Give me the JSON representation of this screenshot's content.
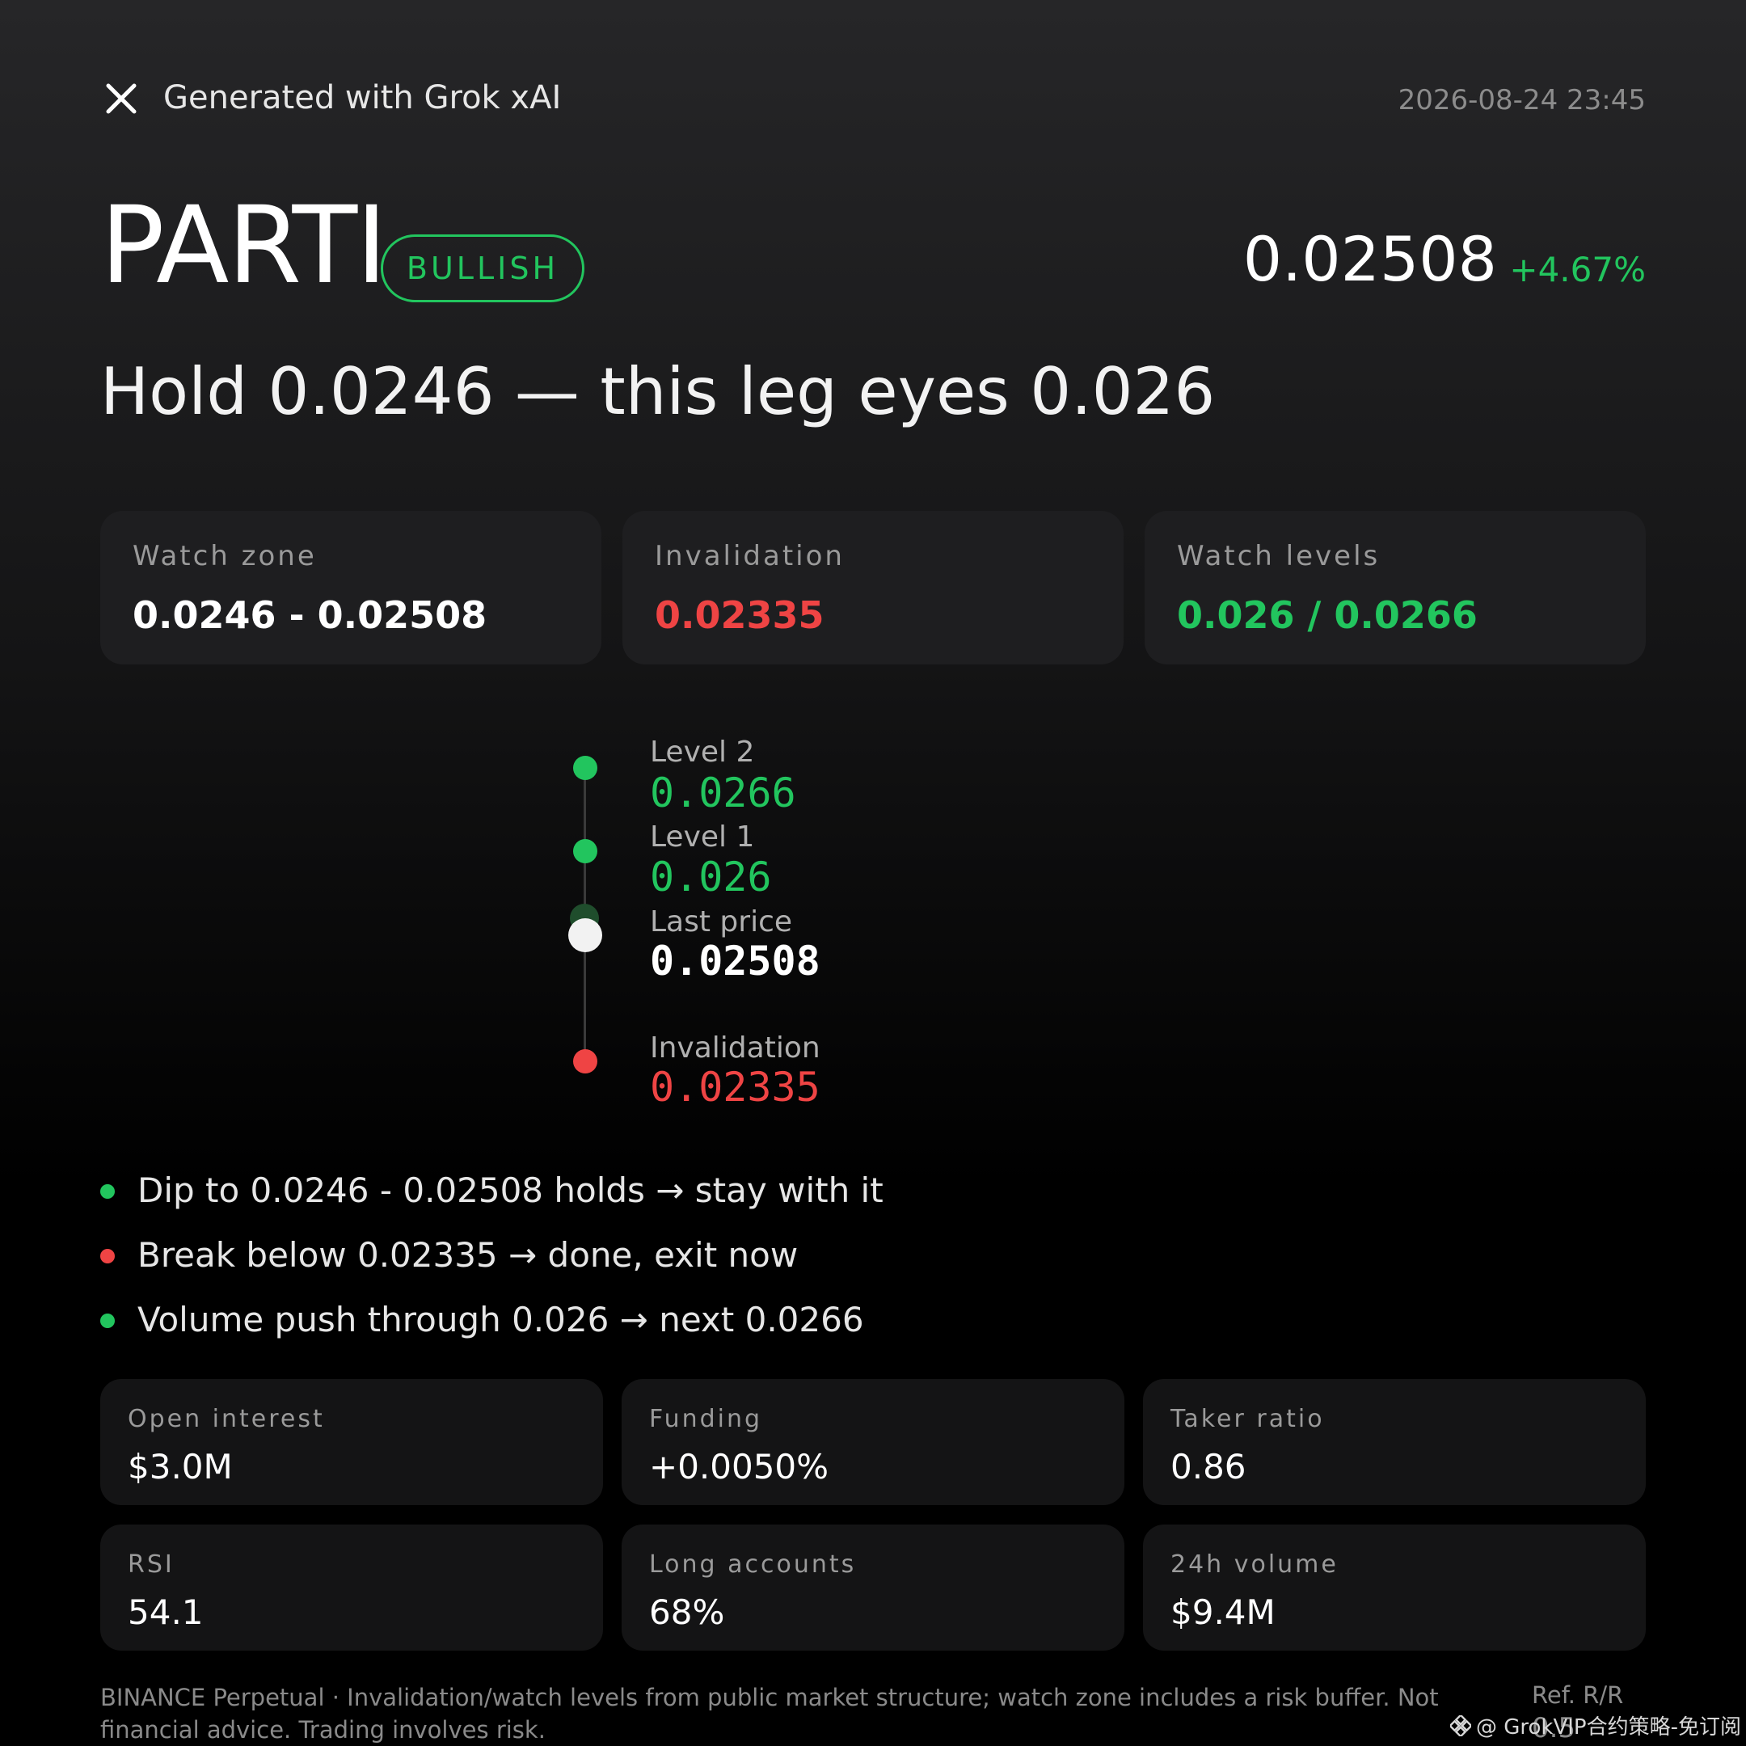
{
  "header": {
    "brand": "Generated with Grok xAI",
    "timestamp": "2026-08-24 23:45"
  },
  "title": {
    "symbol": "PARTI",
    "badge": "BULLISH",
    "price": "0.02508",
    "change": "+4.67%",
    "headline": "Hold 0.0246 — this leg eyes 0.026"
  },
  "level_cards": [
    {
      "label": "Watch zone",
      "value": "0.0246 - 0.02508"
    },
    {
      "label": "Invalidation",
      "value": "0.02335"
    },
    {
      "label": "Watch levels",
      "value": "0.026 / 0.0266"
    }
  ],
  "ladder": [
    {
      "label": "Level 2",
      "value": "0.0266"
    },
    {
      "label": "Level 1",
      "value": "0.026"
    },
    {
      "label": "Last price",
      "value": "0.02508"
    },
    {
      "label": "Invalidation",
      "value": "0.02335"
    }
  ],
  "bullets": [
    {
      "text": "Dip to 0.0246 - 0.02508 holds → stay with it",
      "status": "positive"
    },
    {
      "text": "Break below 0.02335 → done, exit now",
      "status": "negative"
    },
    {
      "text": "Volume push through 0.026 → next 0.0266",
      "status": "positive"
    }
  ],
  "stats": [
    {
      "label": "Open interest",
      "value": "$3.0M"
    },
    {
      "label": "Funding",
      "value": "+0.0050%"
    },
    {
      "label": "Taker ratio",
      "value": "0.86"
    },
    {
      "label": "RSI",
      "value": "54.1"
    },
    {
      "label": "Long accounts",
      "value": "68%"
    },
    {
      "label": "24h volume",
      "value": "$9.4M"
    }
  ],
  "footer": {
    "disclaimer": "BINANCE Perpetual · Invalidation/watch levels from public market structure; watch zone includes a risk buffer. Not financial advice. Trading involves risk.",
    "ref_label": "Ref. R/R",
    "ref_value": "0.5",
    "watermark": "@ GrokVIP合约策略-免订阅"
  },
  "colors": {
    "positive": "#22c55e",
    "negative": "#ef4444",
    "text": "#ffffff",
    "muted": "#9a9a9a"
  }
}
